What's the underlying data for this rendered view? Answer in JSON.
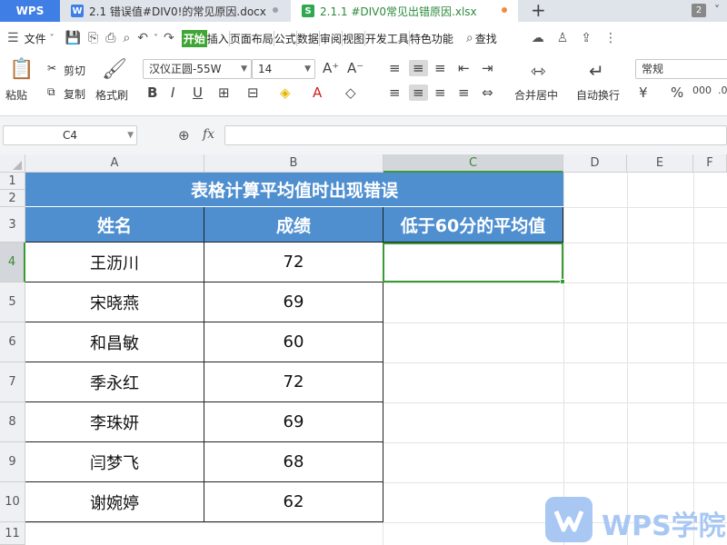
{
  "tabs": {
    "wps_label": "WPS",
    "docx_icon": "W",
    "docx_title": "2.1 错误值#DIV0!的常见原因.docx",
    "xlsx_icon": "S",
    "xlsx_title": "2.1.1 #DIV0常见出错原因.xlsx",
    "new_tab_label": "+",
    "window_count": "2",
    "docx_dot_color": "#9aa3ad",
    "xlsx_dot_color": "#f08a3c"
  },
  "menu": {
    "file": "文件",
    "items": [
      "开始",
      "插入",
      "页面布局",
      "公式",
      "数据",
      "审阅",
      "视图",
      "开发工具",
      "特色功能"
    ],
    "search": "查找"
  },
  "ribbon": {
    "paste": "粘贴",
    "cut": "剪切",
    "copy": "复制",
    "format_painter": "格式刷",
    "font_name": "汉仪正圆-55W",
    "font_size": "14",
    "merge_center": "合并居中",
    "wrap_text": "自动换行",
    "number_format": "常规"
  },
  "formula_bar": {
    "cell_ref": "C4",
    "formula": ""
  },
  "columns": [
    "A",
    "B",
    "C",
    "D",
    "E",
    "F"
  ],
  "active_column": "C",
  "rows": [
    "1",
    "2",
    "3",
    "4",
    "5",
    "6",
    "7",
    "8",
    "9",
    "10",
    "11"
  ],
  "active_row": "4",
  "sheet": {
    "title": "表格计算平均值时出现错误",
    "headers": [
      "姓名",
      "成绩",
      "低于60分的平均值"
    ],
    "records": [
      {
        "name": "王沥川",
        "score": "72",
        "avg": ""
      },
      {
        "name": "宋晓燕",
        "score": "69"
      },
      {
        "name": "和昌敏",
        "score": "60"
      },
      {
        "name": "季永红",
        "score": "72"
      },
      {
        "name": "李珠妍",
        "score": "69"
      },
      {
        "name": "闫梦飞",
        "score": "68"
      },
      {
        "name": "谢婉婷",
        "score": "62"
      }
    ]
  },
  "watermark": {
    "text": "WPS学院",
    "color": "#a8c8f3"
  },
  "colors": {
    "header_fill": "#4f8fd0",
    "selection": "#3a9a34",
    "tab_accent": "#3f7fe5"
  }
}
